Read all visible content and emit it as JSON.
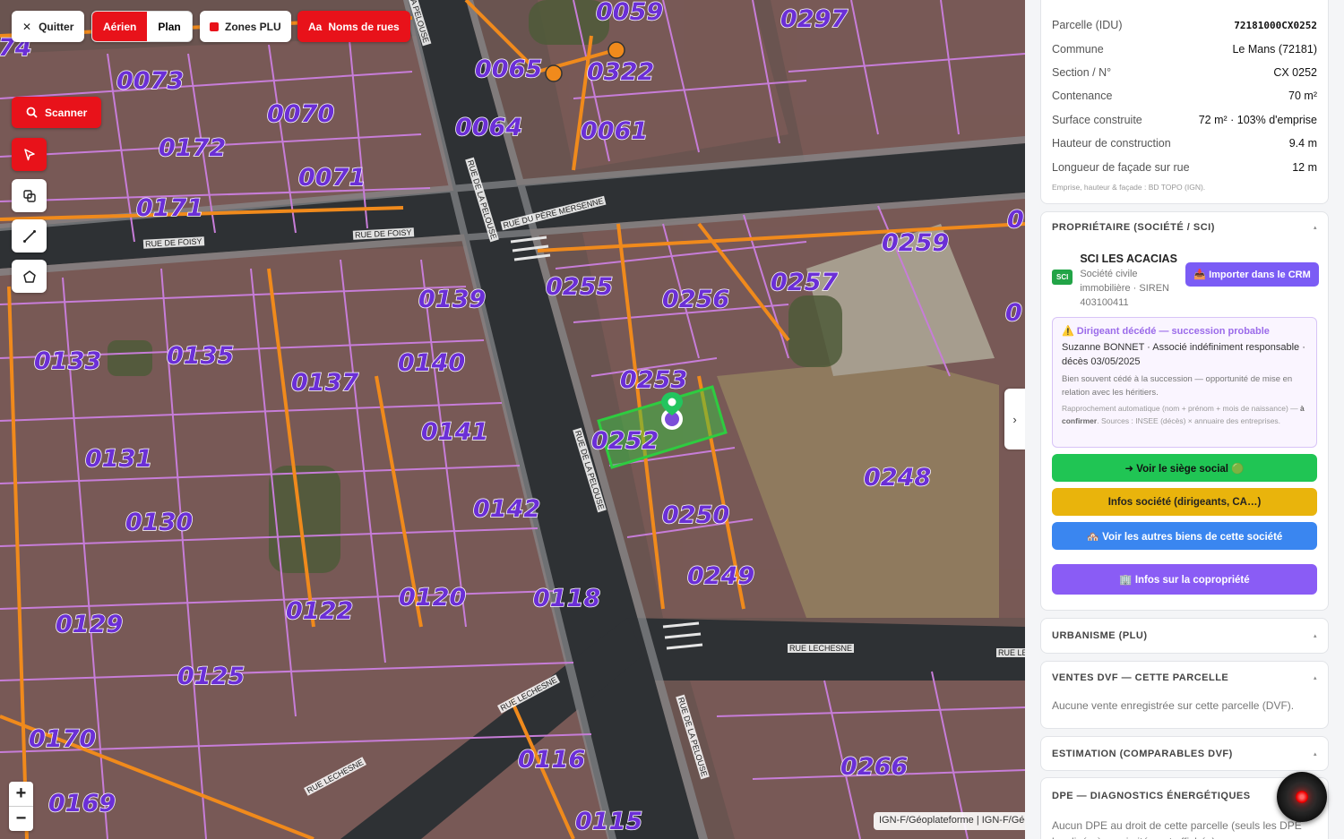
{
  "map": {
    "toolbar": {
      "quit_label": "Quitter",
      "aerial_label": "Aérien",
      "plan_label": "Plan",
      "plu_label": "Zones PLU",
      "street_names_label": "Noms de rues",
      "street_names_icon": "Aa",
      "scan_label": "Scanner"
    },
    "parcels": [
      {
        "id": "p1",
        "label": "74"
      },
      {
        "id": "p2",
        "label": "0073"
      },
      {
        "id": "p3",
        "label": "0070"
      },
      {
        "id": "p4",
        "label": "0172"
      },
      {
        "id": "p5",
        "label": "0071"
      },
      {
        "id": "p6",
        "label": "0171"
      },
      {
        "id": "p7",
        "label": "0065"
      },
      {
        "id": "p8",
        "label": "0059"
      },
      {
        "id": "p9",
        "label": "0322"
      },
      {
        "id": "p10",
        "label": "0297"
      },
      {
        "id": "p11",
        "label": "0064"
      },
      {
        "id": "p12",
        "label": "0061"
      },
      {
        "id": "p13",
        "label": "0139"
      },
      {
        "id": "p14",
        "label": "0255"
      },
      {
        "id": "p15",
        "label": "0256"
      },
      {
        "id": "p16",
        "label": "0257"
      },
      {
        "id": "p17",
        "label": "0259"
      },
      {
        "id": "p18",
        "label": "0133"
      },
      {
        "id": "p19",
        "label": "0135"
      },
      {
        "id": "p20",
        "label": "0137"
      },
      {
        "id": "p21",
        "label": "0140"
      },
      {
        "id": "p22",
        "label": "0253"
      },
      {
        "id": "p23",
        "label": "0141"
      },
      {
        "id": "p24",
        "label": "0252"
      },
      {
        "id": "p25",
        "label": "0131"
      },
      {
        "id": "p26",
        "label": "0248"
      },
      {
        "id": "p27",
        "label": "0142"
      },
      {
        "id": "p28",
        "label": "0250"
      },
      {
        "id": "p29",
        "label": "0130"
      },
      {
        "id": "p30",
        "label": "0249"
      },
      {
        "id": "p31",
        "label": "0120"
      },
      {
        "id": "p32",
        "label": "0118"
      },
      {
        "id": "p33",
        "label": "0122"
      },
      {
        "id": "p34",
        "label": "0129"
      },
      {
        "id": "p35",
        "label": "0125"
      },
      {
        "id": "p36",
        "label": "0170"
      },
      {
        "id": "p37",
        "label": "0116"
      },
      {
        "id": "p38",
        "label": "0266"
      },
      {
        "id": "p39",
        "label": "0169"
      },
      {
        "id": "p40",
        "label": "0115"
      },
      {
        "id": "p41",
        "label": "0"
      },
      {
        "id": "p42",
        "label": "0"
      }
    ],
    "streets": [
      {
        "id": "s1",
        "label": "RUE DE FOISY"
      },
      {
        "id": "s2",
        "label": "RUE DE FOISY"
      },
      {
        "id": "s3",
        "label": "RUE DU PÈRE MERSENNE"
      },
      {
        "id": "s4",
        "label": "RUE DE LA PELOUSE"
      },
      {
        "id": "s5",
        "label": "RUE DE LA PELOUSE"
      },
      {
        "id": "s6",
        "label": "RUE DE LA PELOUSE"
      },
      {
        "id": "s7",
        "label": "RUE LECHESNE"
      },
      {
        "id": "s8",
        "label": "RUE LECHESNE"
      },
      {
        "id": "s9",
        "label": "RUE LECHESNE"
      },
      {
        "id": "s10",
        "label": "RUE LE"
      },
      {
        "id": "s11",
        "label": "LA PELOUSE"
      }
    ],
    "zoom_in": "+",
    "zoom_out": "−",
    "attribution": "IGN-F/Géoplateforme | IGN-F/Géoplateforme",
    "collapse_label": "›"
  },
  "panel": {
    "info": {
      "rows": [
        {
          "k": "Parcelle (IDU)",
          "v": "72181000CX0252"
        },
        {
          "k": "Commune",
          "v": "Le Mans (72181)"
        },
        {
          "k": "Section / N°",
          "v": "CX 0252"
        },
        {
          "k": "Contenance",
          "v": "70 m²"
        },
        {
          "k": "Surface construite",
          "v": "72 m² · 103% d'emprise"
        },
        {
          "k": "Hauteur de construction",
          "v": "9.4 m"
        },
        {
          "k": "Longueur de façade sur rue",
          "v": "12 m"
        }
      ],
      "note": "Emprise, hauteur & façade : BD TOPO (IGN)."
    },
    "owner": {
      "title": "PROPRIÉTAIRE (SOCIÉTÉ / SCI)",
      "badge": "SCI",
      "name": "SCI LES ACACIAS",
      "sub": "Société civile immobilière · SIREN 403100411",
      "crm_button": "📥 Importer dans le CRM",
      "alert_title": "⚠️ Dirigeant décédé — succession probable",
      "alert_p1": "Suzanne BONNET · Associé indéfiniment responsable · décès 03/05/2025",
      "alert_p2": "Bien souvent cédé à la succession — opportunité de mise en relation avec les héritiers.",
      "alert_p3_a": "Rapprochement automatique (nom + prénom + mois de naissance) — ",
      "alert_p3_b": "à confirmer",
      "alert_p3_c": ". Sources : INSEE (décès) × annuaire des entreprises.",
      "btn_siege": "➜ Voir le siège social 🟢",
      "btn_infos": "Infos société (dirigeants, CA…)",
      "btn_biens": "🏘️ Voir les autres biens de cette société",
      "btn_copro": "🏢 Infos sur la copropriété"
    },
    "plu_title": "URBANISME (PLU)",
    "dvf": {
      "title": "VENTES DVF — CETTE PARCELLE",
      "text": "Aucune vente enregistrée sur cette parcelle (DVF)."
    },
    "estimation_title": "ESTIMATION (COMPARABLES DVF)",
    "dpe": {
      "title": "DPE — DIAGNOSTICS ÉNERGÉTIQUES",
      "text": "Aucun DPE au droit de cette parcelle (seuls les DPE localisés à proximité sont affichés)."
    },
    "chevron": "▴"
  },
  "colors": {
    "accent_red": "#e8121a",
    "parcel_label": "#6b2fd6",
    "parcel_outline": "#c77dd8",
    "plu_orange": "#f08a1c",
    "selected_green": "#2ecc40"
  }
}
